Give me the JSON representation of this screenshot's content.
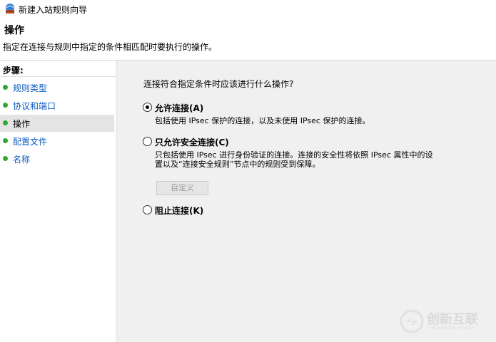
{
  "window": {
    "title": "新建入站规则向导"
  },
  "header": {
    "title": "操作",
    "description": "指定在连接与规则中指定的条件相匹配时要执行的操作。"
  },
  "sidebar": {
    "steps_label": "步骤:",
    "items": [
      {
        "label": "规则类型",
        "state": "done"
      },
      {
        "label": "协议和端口",
        "state": "done"
      },
      {
        "label": "操作",
        "state": "current"
      },
      {
        "label": "配置文件",
        "state": "pending"
      },
      {
        "label": "名称",
        "state": "pending"
      }
    ]
  },
  "main": {
    "question": "连接符合指定条件时应该进行什么操作?",
    "options": [
      {
        "label": "允许连接(A)",
        "description": "包括使用 IPsec 保护的连接，以及未使用 IPsec 保护的连接。",
        "checked": true
      },
      {
        "label": "只允许安全连接(C)",
        "description_line1": "只包括使用 IPsec 进行身份验证的连接。连接的安全性将依照 IPsec 属性中的设",
        "description_line2": "置以及“连接安全规则”节点中的规则受到保障。",
        "checked": false
      },
      {
        "label": "阻止连接(K)",
        "checked": false
      }
    ],
    "customize_button": "自定义"
  },
  "watermark": {
    "text": "创新互联",
    "subtext": "CHUANG XIN HU LIAN"
  },
  "colors": {
    "accent_link": "#0b5cbe",
    "step_dot": "#2fa82f",
    "content_bg": "#f0f0f0"
  }
}
